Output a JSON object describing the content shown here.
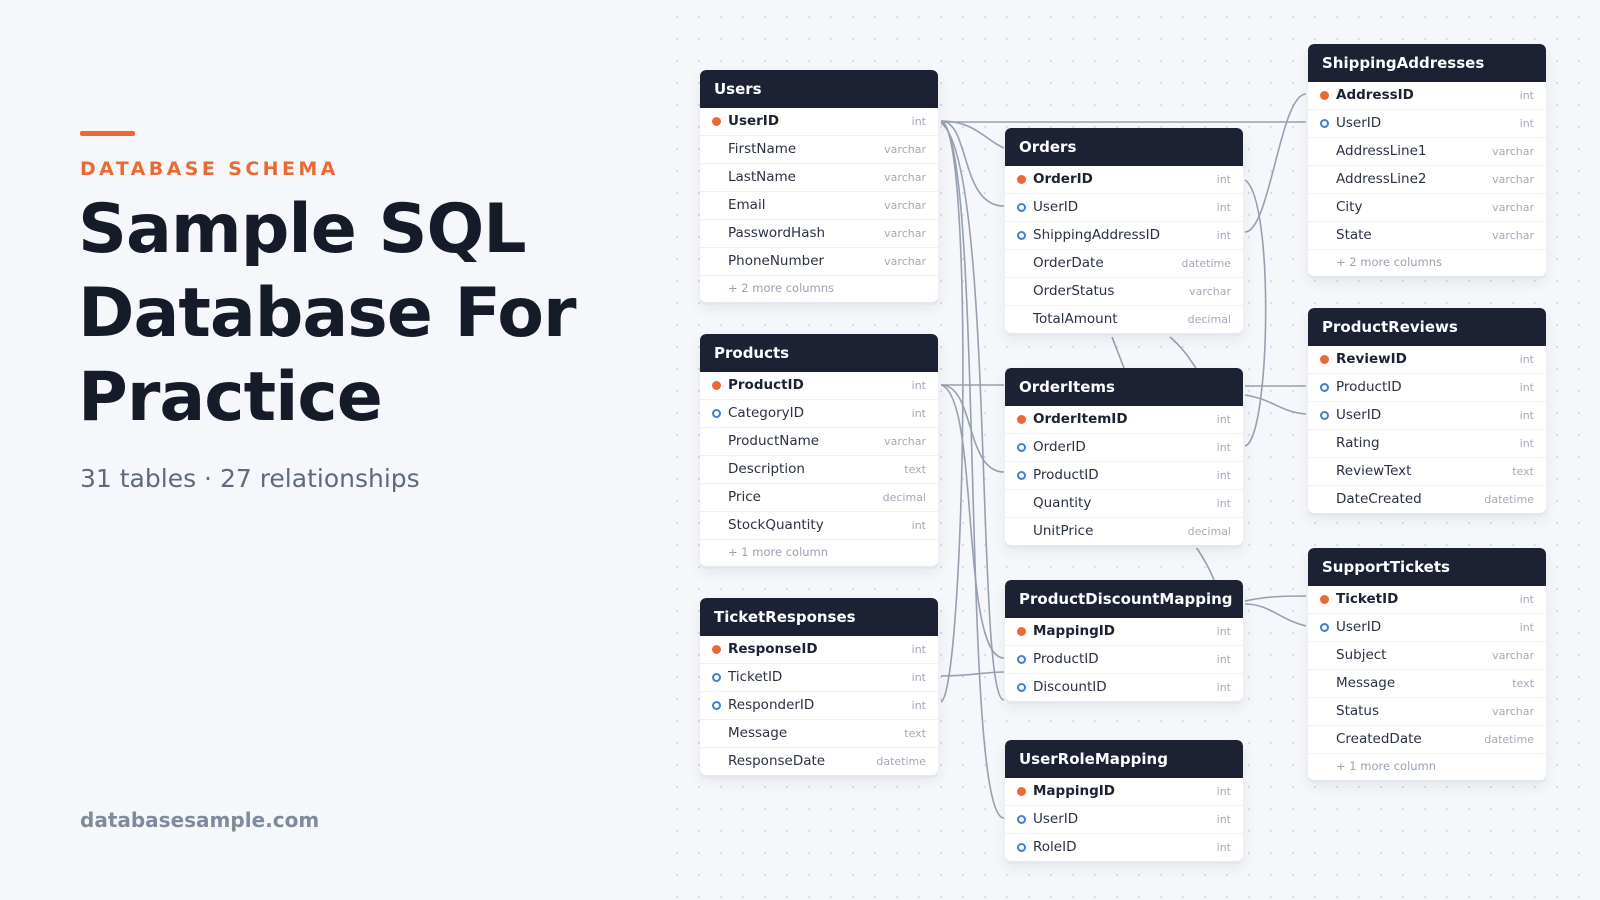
{
  "hero": {
    "eyebrow": "DATABASE SCHEMA",
    "title": "Sample SQL Database For Practice",
    "subtitle": "31 tables · 27 relationships",
    "site": "databasesample.com"
  },
  "colors": {
    "accent": "#ea6a33",
    "header_bg": "#1c2233",
    "foreign_key": "#3f7fd6",
    "link": "#96a0b0",
    "background": "#f5f7fa"
  },
  "tables": [
    {
      "name": "Users",
      "columns": [
        {
          "name": "UserID",
          "type": "int",
          "key": "pk"
        },
        {
          "name": "FirstName",
          "type": "varchar",
          "key": ""
        },
        {
          "name": "LastName",
          "type": "varchar",
          "key": ""
        },
        {
          "name": "Email",
          "type": "varchar",
          "key": ""
        },
        {
          "name": "PasswordHash",
          "type": "varchar",
          "key": ""
        },
        {
          "name": "PhoneNumber",
          "type": "varchar",
          "key": ""
        }
      ],
      "more": "+ 2 more columns"
    },
    {
      "name": "Products",
      "columns": [
        {
          "name": "ProductID",
          "type": "int",
          "key": "pk"
        },
        {
          "name": "CategoryID",
          "type": "int",
          "key": "fk"
        },
        {
          "name": "ProductName",
          "type": "varchar",
          "key": ""
        },
        {
          "name": "Description",
          "type": "text",
          "key": ""
        },
        {
          "name": "Price",
          "type": "decimal",
          "key": ""
        },
        {
          "name": "StockQuantity",
          "type": "int",
          "key": ""
        }
      ],
      "more": "+ 1 more column"
    },
    {
      "name": "TicketResponses",
      "columns": [
        {
          "name": "ResponseID",
          "type": "int",
          "key": "pk"
        },
        {
          "name": "TicketID",
          "type": "int",
          "key": "fk"
        },
        {
          "name": "ResponderID",
          "type": "int",
          "key": "fk"
        },
        {
          "name": "Message",
          "type": "text",
          "key": ""
        },
        {
          "name": "ResponseDate",
          "type": "datetime",
          "key": ""
        }
      ],
      "more": ""
    },
    {
      "name": "Orders",
      "columns": [
        {
          "name": "OrderID",
          "type": "int",
          "key": "pk"
        },
        {
          "name": "UserID",
          "type": "int",
          "key": "fk"
        },
        {
          "name": "ShippingAddressID",
          "type": "int",
          "key": "fk"
        },
        {
          "name": "OrderDate",
          "type": "datetime",
          "key": ""
        },
        {
          "name": "OrderStatus",
          "type": "varchar",
          "key": ""
        },
        {
          "name": "TotalAmount",
          "type": "decimal",
          "key": ""
        }
      ],
      "more": ""
    },
    {
      "name": "OrderItems",
      "columns": [
        {
          "name": "OrderItemID",
          "type": "int",
          "key": "pk"
        },
        {
          "name": "OrderID",
          "type": "int",
          "key": "fk"
        },
        {
          "name": "ProductID",
          "type": "int",
          "key": "fk"
        },
        {
          "name": "Quantity",
          "type": "int",
          "key": ""
        },
        {
          "name": "UnitPrice",
          "type": "decimal",
          "key": ""
        }
      ],
      "more": ""
    },
    {
      "name": "ProductDiscountMapping",
      "columns": [
        {
          "name": "MappingID",
          "type": "int",
          "key": "pk"
        },
        {
          "name": "ProductID",
          "type": "int",
          "key": "fk"
        },
        {
          "name": "DiscountID",
          "type": "int",
          "key": "fk"
        }
      ],
      "more": ""
    },
    {
      "name": "UserRoleMapping",
      "columns": [
        {
          "name": "MappingID",
          "type": "int",
          "key": "pk"
        },
        {
          "name": "UserID",
          "type": "int",
          "key": "fk"
        },
        {
          "name": "RoleID",
          "type": "int",
          "key": "fk"
        }
      ],
      "more": ""
    },
    {
      "name": "ShippingAddresses",
      "columns": [
        {
          "name": "AddressID",
          "type": "int",
          "key": "pk"
        },
        {
          "name": "UserID",
          "type": "int",
          "key": "fk"
        },
        {
          "name": "AddressLine1",
          "type": "varchar",
          "key": ""
        },
        {
          "name": "AddressLine2",
          "type": "varchar",
          "key": ""
        },
        {
          "name": "City",
          "type": "varchar",
          "key": ""
        },
        {
          "name": "State",
          "type": "varchar",
          "key": ""
        }
      ],
      "more": "+ 2 more columns"
    },
    {
      "name": "ProductReviews",
      "columns": [
        {
          "name": "ReviewID",
          "type": "int",
          "key": "pk"
        },
        {
          "name": "ProductID",
          "type": "int",
          "key": "fk"
        },
        {
          "name": "UserID",
          "type": "int",
          "key": "fk"
        },
        {
          "name": "Rating",
          "type": "int",
          "key": ""
        },
        {
          "name": "ReviewText",
          "type": "text",
          "key": ""
        },
        {
          "name": "DateCreated",
          "type": "datetime",
          "key": ""
        }
      ],
      "more": ""
    },
    {
      "name": "SupportTickets",
      "columns": [
        {
          "name": "TicketID",
          "type": "int",
          "key": "pk"
        },
        {
          "name": "UserID",
          "type": "int",
          "key": "fk"
        },
        {
          "name": "Subject",
          "type": "varchar",
          "key": ""
        },
        {
          "name": "Message",
          "type": "text",
          "key": ""
        },
        {
          "name": "Status",
          "type": "varchar",
          "key": ""
        },
        {
          "name": "CreatedDate",
          "type": "datetime",
          "key": ""
        }
      ],
      "more": "+ 1 more column"
    }
  ]
}
